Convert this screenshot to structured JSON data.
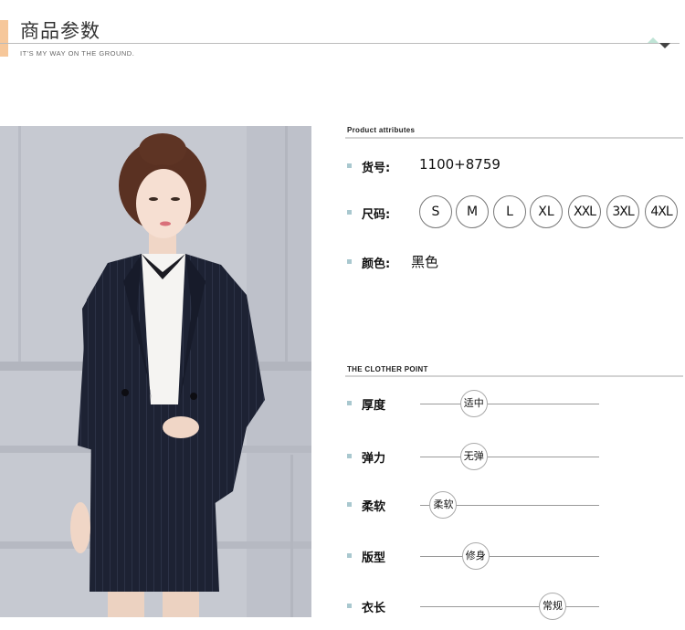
{
  "header": {
    "title": "商品参数",
    "subtitle": "IT'S MY WAY ON THE GROUND."
  },
  "attributes": {
    "section_title": "Product attributes",
    "item_no": {
      "label": "货号:",
      "value": "1100+8759"
    },
    "size": {
      "label": "尺码:",
      "options": [
        "S",
        "M",
        "L",
        "XL",
        "XXL",
        "3XL",
        "4XL"
      ]
    },
    "color": {
      "label": "颜色:",
      "value": "黑色"
    }
  },
  "points": {
    "section_title": "THE CLOTHER POINT",
    "items": [
      {
        "label": "厚度",
        "value": "适中",
        "level": 0.3
      },
      {
        "label": "弹力",
        "value": "无弹",
        "level": 0.3
      },
      {
        "label": "柔软",
        "value": "柔软",
        "level": 0.13
      },
      {
        "label": "版型",
        "value": "修身",
        "level": 0.31
      },
      {
        "label": "衣长",
        "value": "常规",
        "level": 0.74
      }
    ]
  },
  "colors": {
    "accent": "#f6c79a",
    "bullet": "#a9c8cf",
    "header_mark": "#bfe4d6"
  }
}
